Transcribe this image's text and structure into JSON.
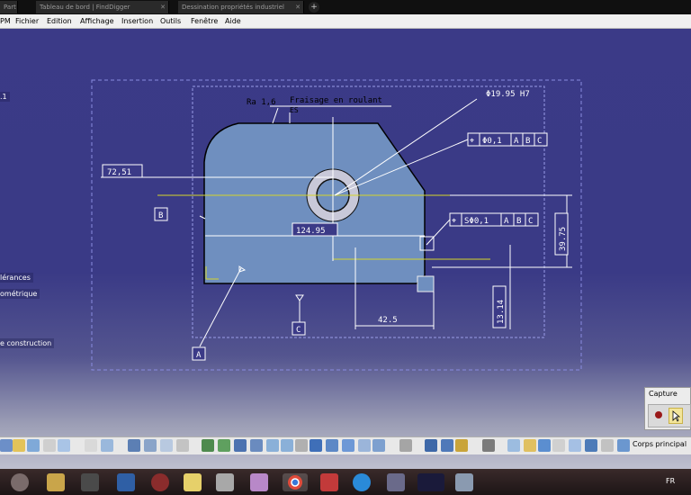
{
  "tabs": [
    {
      "label": "Part"
    },
    {
      "label": "Tableau de bord | FindDigger"
    },
    {
      "label": "Dessination propriétés industriel"
    }
  ],
  "menu": [
    "PM",
    "Fichier",
    "Edition",
    "Affichage",
    "Insertion",
    "Outils",
    "Fenêtre",
    "Aide"
  ],
  "tree": {
    "item1": ".1",
    "tolerances": "lérances",
    "geometrique": "ométrique",
    "construction": "e construction"
  },
  "annotations": {
    "ra": "Ra 1,6",
    "machining": "Fraisage en roulant",
    "es": "ES",
    "diameter": "Φ19.95 H7",
    "frame1_value": "Φ0,1",
    "frame1_d1": "A",
    "frame1_d2": "B",
    "frame1_d3": "C",
    "frame2_value": "SΦ0,1",
    "frame2_d1": "A",
    "frame2_d2": "B",
    "frame2_d3": "C",
    "dim_7251": "72,51",
    "dim_12495": "124.95",
    "dim_3975": "39.75",
    "dim_425": "42.5",
    "dim_1314": "13.14",
    "datum_a": "A",
    "datum_b": "B",
    "datum_c": "C"
  },
  "capture": {
    "title": "Capture"
  },
  "toolbar": {
    "body_selector": "Corps principal"
  },
  "taskbar": {
    "language": "FR"
  },
  "colors": {
    "background": "#3b3a87",
    "part_fill": "#6f8fbf",
    "dimension": "#ffffff",
    "axis_yellow": "#d6d629",
    "hole_ring": "#c8c8d8"
  }
}
